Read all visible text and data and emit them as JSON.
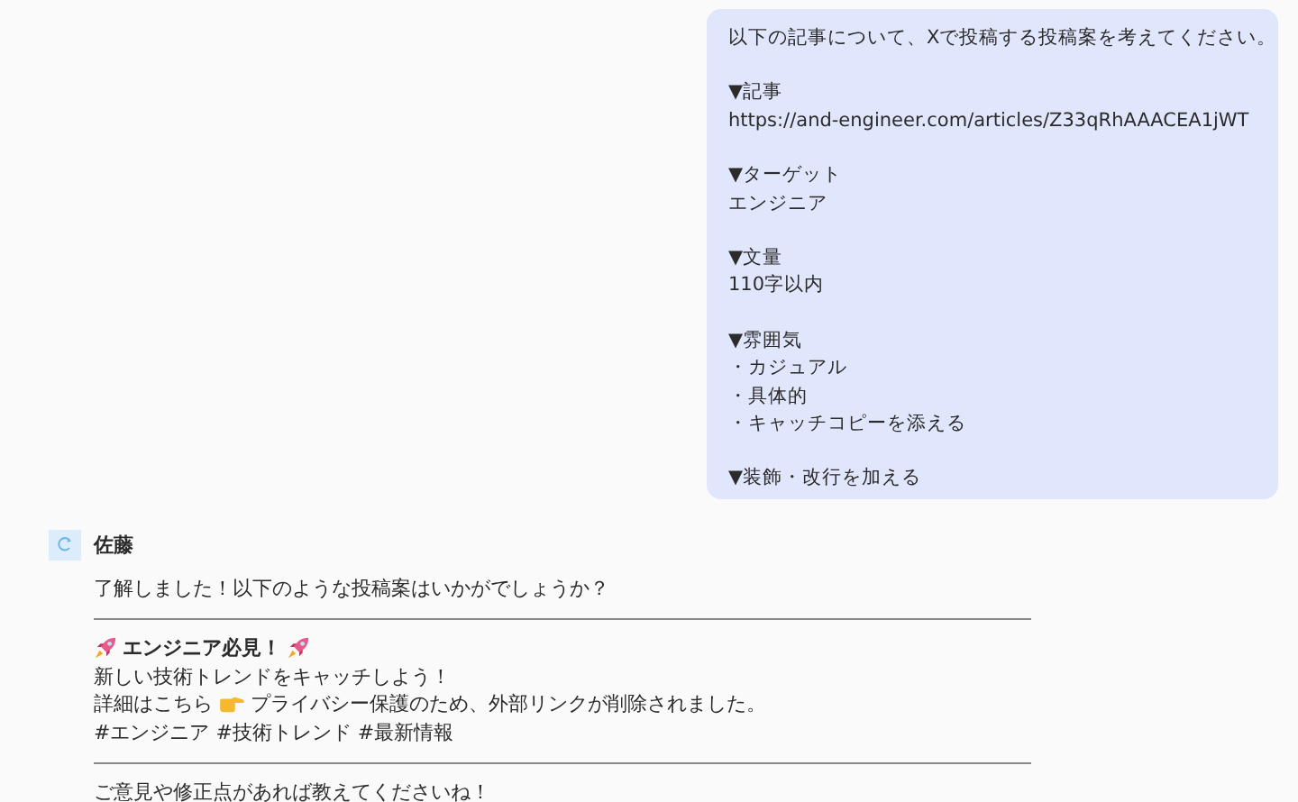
{
  "user_message": {
    "intro": "以下の記事について、Xで投稿する投稿案を考えてください。",
    "sections": [
      {
        "heading": "▼記事",
        "lines": [
          "https://and-engineer.com/articles/Z33qRhAAACEA1jWT"
        ]
      },
      {
        "heading": "▼ターゲット",
        "lines": [
          "エンジニア"
        ]
      },
      {
        "heading": "▼文量",
        "lines": [
          "110字以内"
        ]
      },
      {
        "heading": "▼雰囲気",
        "lines": [
          "・カジュアル",
          "・具体的",
          "・キャッチコピーを添える"
        ]
      },
      {
        "heading": "▼装飾・改行を加える"
      }
    ]
  },
  "assistant_message": {
    "name": "佐藤",
    "intro": "了解しました！以下のような投稿案はいかがでしょうか？",
    "post": {
      "headline": "エンジニア必見！",
      "catchphrase": "新しい技術トレンドをキャッチしよう！",
      "detail_lead": "詳細はこちら",
      "detail_note": "プライバシー保護のため、外部リンクが削除されました。",
      "hashtags": "#エンジニア #技術トレンド #最新情報"
    },
    "outro": "ご意見や修正点があれば教えてくださいね！"
  }
}
